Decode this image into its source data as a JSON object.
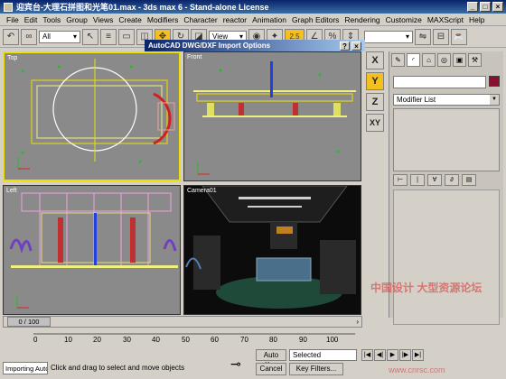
{
  "window": {
    "title": "迎宾台-大理石拼图和光笔01.max - 3ds max 6 - Stand-alone License",
    "min": "_",
    "max": "□",
    "close": "×"
  },
  "menu": [
    "File",
    "Edit",
    "Tools",
    "Group",
    "Views",
    "Create",
    "Modifiers",
    "Character",
    "reactor",
    "Animation",
    "Graph Editors",
    "Rendering",
    "Customize",
    "MAXScript",
    "Help"
  ],
  "toolbar": {
    "selection_filter": "All",
    "reference_coord": "View",
    "snap_value": "2.5"
  },
  "dialog": {
    "title": "AutoCAD DWG/DXF Import Options",
    "help": "?",
    "close": "×"
  },
  "viewports": {
    "top": "Top",
    "front": "Front",
    "left": "Left",
    "camera": "Camera01"
  },
  "axis_constraints": [
    "X",
    "Y",
    "Z",
    "XY"
  ],
  "command_panel": {
    "modifier_list": "Modifier List"
  },
  "time_slider": {
    "position": "0 / 100",
    "current_frame": 0,
    "total_frames": 100
  },
  "trackbar_ticks": [
    "0",
    "10",
    "20",
    "30",
    "40",
    "50",
    "60",
    "70",
    "80",
    "90",
    "100"
  ],
  "status": {
    "prompt_box": "Importing Auto",
    "prompt_text": "Click and drag to select and move objects",
    "auto_key": "Auto Key",
    "set_key": "Cancel",
    "key_mode": "Selected",
    "key_filters": "Key Filters..."
  },
  "watermark": {
    "text": "中国设计 大型资源论坛",
    "url": "www.cnrsc.com"
  },
  "colors": {
    "title_bar": "#0a246a",
    "active_viewport_border": "#f0e000",
    "active_button": "#f4c020",
    "object_color": "#8b1030"
  }
}
